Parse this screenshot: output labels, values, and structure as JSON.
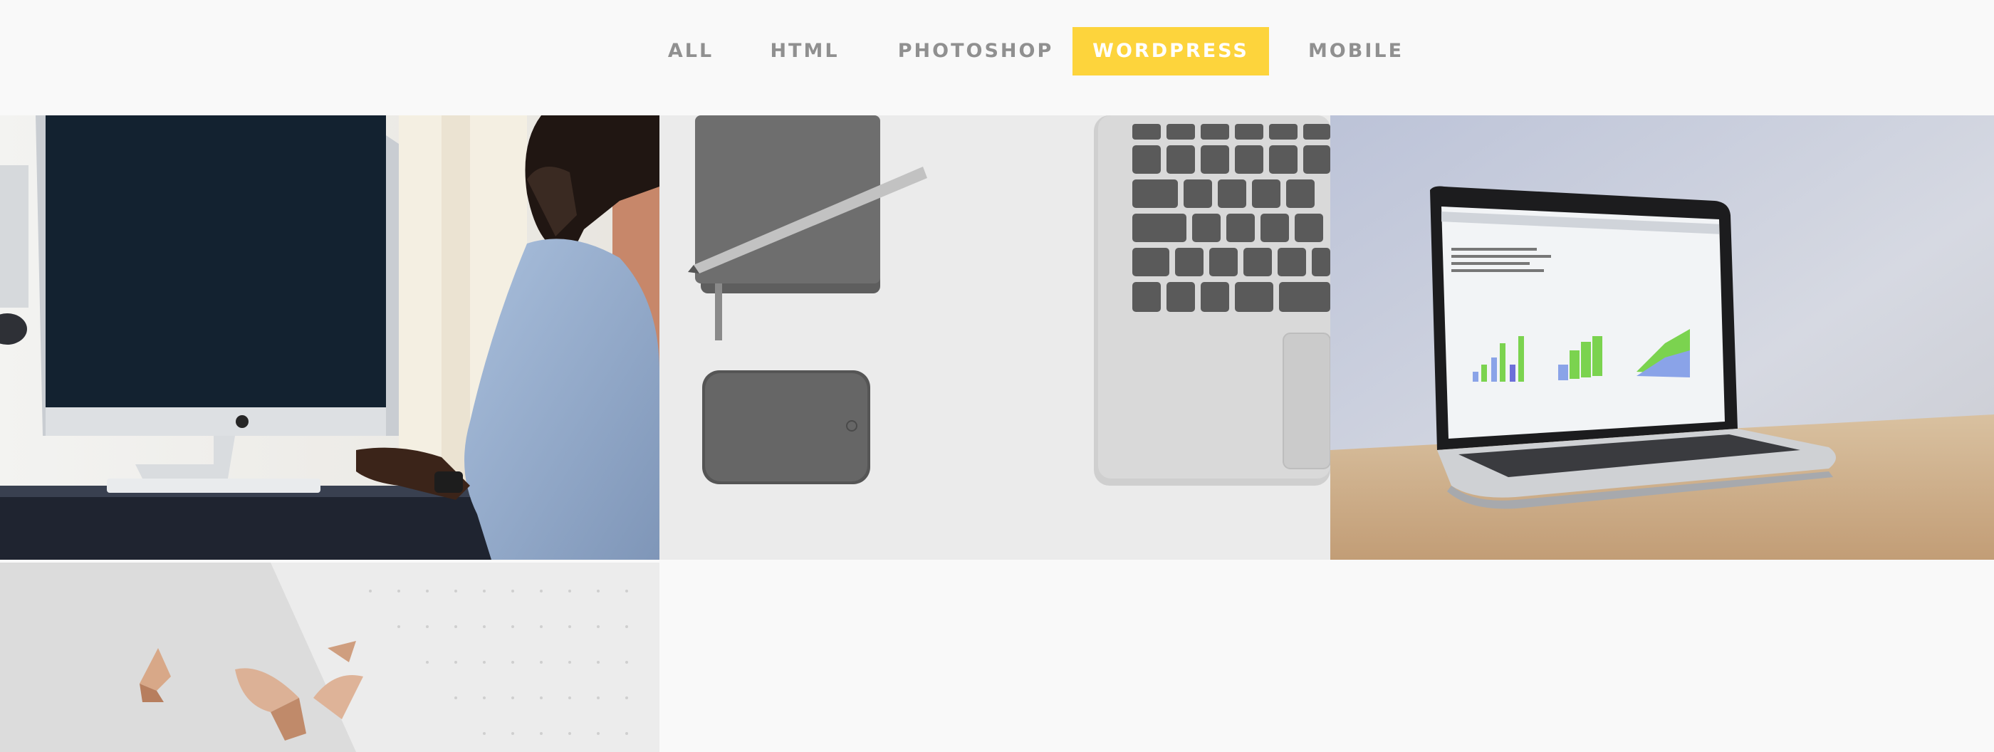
{
  "filters": {
    "items": [
      {
        "label": "ALL"
      },
      {
        "label": "HTML"
      },
      {
        "label": "PHOTOSHOP"
      },
      {
        "label": "WORDPRESS",
        "active": true
      },
      {
        "label": "MOBILE"
      }
    ],
    "active_color": "#fdd43c",
    "inactive_color": "#909090"
  },
  "gallery": {
    "items": [
      {
        "name": "workspace-imac-photo"
      },
      {
        "name": "notebook-phone-keyboard-photo"
      },
      {
        "name": "laptop-chart-photo"
      },
      {
        "name": "pencil-shavings-photo"
      }
    ]
  }
}
